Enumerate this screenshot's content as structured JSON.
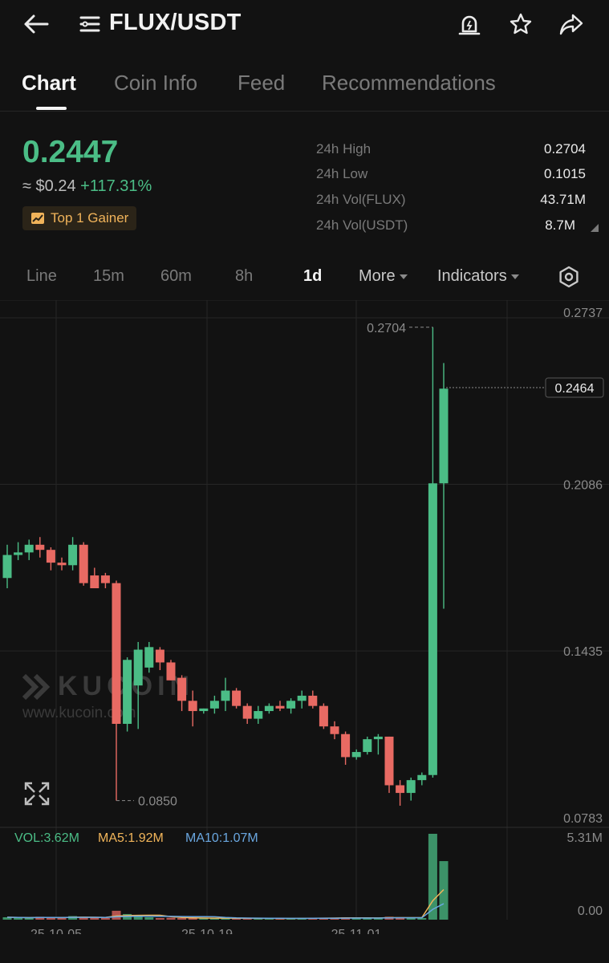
{
  "header": {
    "back_icon": "arrow-left-icon",
    "menu_icon": "list-icon",
    "pair": "FLUX/USDT",
    "alert_icon": "alarm-bell-icon",
    "favorite_icon": "star-icon",
    "share_icon": "share-arrow-icon"
  },
  "tabs": [
    {
      "label": "Chart",
      "active": true
    },
    {
      "label": "Coin Info",
      "active": false
    },
    {
      "label": "Feed",
      "active": false
    },
    {
      "label": "Recommendations",
      "active": false
    }
  ],
  "ticker": {
    "price": "0.2447",
    "fiat_approx": "≈ $0.24",
    "change_pct": "+117.31%",
    "badge": "Top 1 Gainer",
    "badge_icon": "trend-up-icon"
  },
  "stats": [
    {
      "label": "24h High",
      "value": "0.2704"
    },
    {
      "label": "24h Low",
      "value": "0.1015"
    },
    {
      "label": "24h Vol(FLUX)",
      "value": "43.71M"
    },
    {
      "label": "24h Vol(USDT)",
      "value": "8.7M"
    }
  ],
  "intervals": {
    "items": [
      "Line",
      "15m",
      "60m",
      "8h",
      "1d"
    ],
    "active": "1d",
    "more_label": "More",
    "indicators_label": "Indicators",
    "settings_icon": "hexagon-settings-icon"
  },
  "colors": {
    "up": "#4bbd86",
    "down": "#e86a63",
    "background": "#121212",
    "ma5": "#f1b55a",
    "ma10": "#6aa7e0"
  },
  "watermark": {
    "brand": "KUCOIN",
    "url": "www.kucoin.com"
  },
  "expand_icon": "expand-arrows-icon",
  "volume_legend": {
    "vol": "VOL:3.62M",
    "ma5": "MA5:1.92M",
    "ma10": "MA10:1.07M"
  },
  "chart_data": {
    "type": "candlestick",
    "interval": "1d",
    "y_axis_ticks": [
      "0.2737",
      "0.2086",
      "0.1435",
      "0.0783"
    ],
    "ylim": [
      0.0783,
      0.2737
    ],
    "last_price_label": "0.2464",
    "high_marker": "0.2704",
    "low_marker": "0.0850",
    "x_tick_labels": [
      "25-10-05",
      "25-10-19",
      "25-11-01"
    ],
    "candles": [
      {
        "o": 0.172,
        "h": 0.185,
        "l": 0.168,
        "c": 0.181
      },
      {
        "o": 0.181,
        "h": 0.186,
        "l": 0.179,
        "c": 0.182
      },
      {
        "o": 0.182,
        "h": 0.187,
        "l": 0.179,
        "c": 0.185
      },
      {
        "o": 0.185,
        "h": 0.188,
        "l": 0.18,
        "c": 0.183
      },
      {
        "o": 0.183,
        "h": 0.184,
        "l": 0.175,
        "c": 0.178
      },
      {
        "o": 0.178,
        "h": 0.18,
        "l": 0.175,
        "c": 0.177
      },
      {
        "o": 0.177,
        "h": 0.188,
        "l": 0.175,
        "c": 0.185
      },
      {
        "o": 0.185,
        "h": 0.186,
        "l": 0.169,
        "c": 0.17
      },
      {
        "o": 0.173,
        "h": 0.176,
        "l": 0.17,
        "c": 0.168
      },
      {
        "o": 0.173,
        "h": 0.174,
        "l": 0.168,
        "c": 0.17
      },
      {
        "o": 0.17,
        "h": 0.171,
        "l": 0.085,
        "c": 0.115
      },
      {
        "o": 0.115,
        "h": 0.141,
        "l": 0.112,
        "c": 0.14
      },
      {
        "o": 0.13,
        "h": 0.147,
        "l": 0.113,
        "c": 0.144
      },
      {
        "o": 0.137,
        "h": 0.147,
        "l": 0.135,
        "c": 0.145
      },
      {
        "o": 0.144,
        "h": 0.145,
        "l": 0.136,
        "c": 0.139
      },
      {
        "o": 0.139,
        "h": 0.14,
        "l": 0.132,
        "c": 0.132
      },
      {
        "o": 0.133,
        "h": 0.134,
        "l": 0.12,
        "c": 0.124
      },
      {
        "o": 0.124,
        "h": 0.128,
        "l": 0.114,
        "c": 0.12
      },
      {
        "o": 0.12,
        "h": 0.121,
        "l": 0.119,
        "c": 0.121
      },
      {
        "o": 0.121,
        "h": 0.126,
        "l": 0.119,
        "c": 0.124
      },
      {
        "o": 0.124,
        "h": 0.133,
        "l": 0.12,
        "c": 0.128
      },
      {
        "o": 0.128,
        "h": 0.129,
        "l": 0.121,
        "c": 0.122
      },
      {
        "o": 0.122,
        "h": 0.123,
        "l": 0.115,
        "c": 0.117
      },
      {
        "o": 0.117,
        "h": 0.122,
        "l": 0.115,
        "c": 0.12
      },
      {
        "o": 0.12,
        "h": 0.123,
        "l": 0.119,
        "c": 0.122
      },
      {
        "o": 0.122,
        "h": 0.124,
        "l": 0.12,
        "c": 0.121
      },
      {
        "o": 0.121,
        "h": 0.125,
        "l": 0.119,
        "c": 0.124
      },
      {
        "o": 0.124,
        "h": 0.128,
        "l": 0.121,
        "c": 0.126
      },
      {
        "o": 0.126,
        "h": 0.128,
        "l": 0.121,
        "c": 0.122
      },
      {
        "o": 0.122,
        "h": 0.123,
        "l": 0.113,
        "c": 0.114
      },
      {
        "o": 0.114,
        "h": 0.116,
        "l": 0.109,
        "c": 0.111
      },
      {
        "o": 0.111,
        "h": 0.112,
        "l": 0.099,
        "c": 0.102
      },
      {
        "o": 0.102,
        "h": 0.105,
        "l": 0.101,
        "c": 0.104
      },
      {
        "o": 0.104,
        "h": 0.11,
        "l": 0.103,
        "c": 0.109
      },
      {
        "o": 0.109,
        "h": 0.111,
        "l": 0.103,
        "c": 0.11
      },
      {
        "o": 0.11,
        "h": 0.11,
        "l": 0.088,
        "c": 0.091
      },
      {
        "o": 0.091,
        "h": 0.093,
        "l": 0.083,
        "c": 0.088
      },
      {
        "o": 0.088,
        "h": 0.094,
        "l": 0.085,
        "c": 0.093
      },
      {
        "o": 0.093,
        "h": 0.096,
        "l": 0.091,
        "c": 0.095
      },
      {
        "o": 0.095,
        "h": 0.27,
        "l": 0.094,
        "c": 0.209
      },
      {
        "o": 0.209,
        "h": 0.256,
        "l": 0.16,
        "c": 0.246
      }
    ],
    "volume": {
      "ylim": [
        0,
        5.31
      ],
      "axis_labels": [
        "5.31M",
        "0.00"
      ],
      "values_m": [
        0.15,
        0.12,
        0.1,
        0.18,
        0.14,
        0.1,
        0.22,
        0.15,
        0.12,
        0.1,
        0.55,
        0.35,
        0.2,
        0.15,
        0.1,
        0.12,
        0.1,
        0.1,
        0.08,
        0.08,
        0.1,
        0.08,
        0.08,
        0.07,
        0.07,
        0.08,
        0.08,
        0.1,
        0.1,
        0.12,
        0.1,
        0.15,
        0.1,
        0.08,
        0.1,
        0.18,
        0.15,
        0.12,
        0.1,
        5.31,
        3.62
      ]
    }
  }
}
